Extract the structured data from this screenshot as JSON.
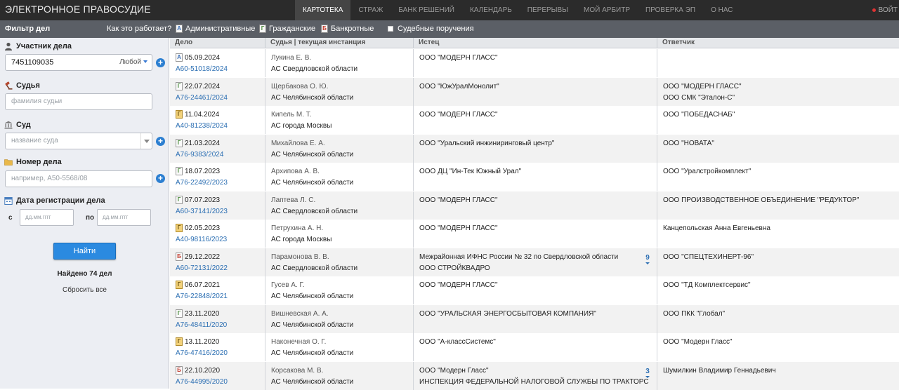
{
  "header": {
    "brand": "ЭЛЕКТРОННОЕ ПРАВОСУДИЕ",
    "nav": [
      "КАРТОТЕКА",
      "СТРАЖ",
      "БАНК РЕШЕНИЙ",
      "КАЛЕНДАРЬ",
      "ПЕРЕРЫВЫ",
      "МОЙ АРБИТР",
      "ПРОВЕРКА ЭП",
      "О НАС"
    ],
    "active_nav": "КАРТОТЕКА",
    "login": "ВОЙТ"
  },
  "filterbar": {
    "title": "Фильтр дел",
    "how": "Как это работает?",
    "types": [
      {
        "icon": "А",
        "label": "Административные"
      },
      {
        "icon": "Г",
        "label": "Гражданские"
      },
      {
        "icon": "Б",
        "label": "Банкротные"
      }
    ],
    "court_orders": "Судебные поручения"
  },
  "sidebar": {
    "participant_label": "Участник дела",
    "participant_value": "7451109035",
    "participant_any": "Любой",
    "judge_label": "Судья",
    "judge_placeholder": "фамилия судьи",
    "court_label": "Суд",
    "court_placeholder": "название суда",
    "case_label": "Номер дела",
    "case_placeholder": "например, А50-5568/08",
    "date_label": "Дата регистрации дела",
    "from_label": "с",
    "to_label": "по",
    "date_placeholder": "дд.мм.гггг",
    "find_button": "Найти",
    "found": "Найдено 74 дел",
    "reset": "Сбросить все"
  },
  "table": {
    "headers": [
      "Дело",
      "Судья | текущая инстанция",
      "Истец",
      "Ответчик"
    ],
    "rows": [
      {
        "type": "А",
        "date": "05.09.2024",
        "case": "А60-51018/2024",
        "judge": "Лукина Е. В.",
        "court": "АС Свердловской области",
        "plaintiff": [
          "ООО \"МОДЕРН ГЛАСС\""
        ],
        "defendant": [],
        "more": ""
      },
      {
        "type": "Г",
        "date": "22.07.2024",
        "case": "А76-24461/2024",
        "judge": "Щербакова О. Ю.",
        "court": "АС Челябинской области",
        "plaintiff": [
          "ООО \"ЮжУралМонолит\""
        ],
        "defendant": [
          "ООО \"МОДЕРН ГЛАСС\"",
          "ООО СМК \"Эталон-С\""
        ],
        "more": ""
      },
      {
        "type": "Г2",
        "date": "11.04.2024",
        "case": "А40-81238/2024",
        "judge": "Кипель М. Т.",
        "court": "АС города Москвы",
        "plaintiff": [
          "ООО \"МОДЕРН ГЛАСС\""
        ],
        "defendant": [
          "ООО \"ПОБЕДАСНАБ\""
        ],
        "more": ""
      },
      {
        "type": "Г",
        "date": "21.03.2024",
        "case": "А76-9383/2024",
        "judge": "Михайлова Е. А.",
        "court": "АС Челябинской области",
        "plaintiff": [
          "ООО \"Уральский инжиниринговый центр\""
        ],
        "defendant": [
          "ООО \"НОВАТА\""
        ],
        "more": ""
      },
      {
        "type": "Г",
        "date": "18.07.2023",
        "case": "А76-22492/2023",
        "judge": "Архипова А. В.",
        "court": "АС Челябинской области",
        "plaintiff": [
          "ООО ДЦ \"Ин-Тек Южный Урал\""
        ],
        "defendant": [
          "ООО \"Уралстройкомплект\""
        ],
        "more": ""
      },
      {
        "type": "Г",
        "date": "07.07.2023",
        "case": "А60-37141/2023",
        "judge": "Лаптева Л. С.",
        "court": "АС Свердловской области",
        "plaintiff": [
          "ООО \"МОДЕРН ГЛАСС\""
        ],
        "defendant": [
          "ООО ПРОИЗВОДСТВЕННОЕ ОБЪЕДИНЕНИЕ \"РЕДУКТОР\""
        ],
        "more": ""
      },
      {
        "type": "Г2",
        "date": "02.05.2023",
        "case": "А40-98116/2023",
        "judge": "Петрухина А. Н.",
        "court": "АС города Москвы",
        "plaintiff": [
          "ООО \"МОДЕРН ГЛАСС\""
        ],
        "defendant": [
          "Канцепольская Анна Евгеньевна"
        ],
        "more": ""
      },
      {
        "type": "Б",
        "date": "29.12.2022",
        "case": "А60-72131/2022",
        "judge": "Парамонова В. В.",
        "court": "АС Свердловской области",
        "plaintiff": [
          "Межрайонная ИФНС России № 32 по Свердловской области",
          "ООО СТРОЙКВАДРО"
        ],
        "defendant": [
          "ООО \"СПЕЦТЕХИНЕРТ-96\""
        ],
        "more": "9"
      },
      {
        "type": "Г2",
        "date": "06.07.2021",
        "case": "А76-22848/2021",
        "judge": "Гусев А. Г.",
        "court": "АС Челябинской области",
        "plaintiff": [
          "ООО \"МОДЕРН ГЛАСС\""
        ],
        "defendant": [
          "ООО \"ТД Комплектсервис\""
        ],
        "more": ""
      },
      {
        "type": "Г",
        "date": "23.11.2020",
        "case": "А76-48411/2020",
        "judge": "Вишневская А. А.",
        "court": "АС Челябинской области",
        "plaintiff": [
          "ООО \"УРАЛЬСКАЯ ЭНЕРГОСБЫТОВАЯ КОМПАНИЯ\""
        ],
        "defendant": [
          "ООО ПКК \"Глобал\""
        ],
        "more": ""
      },
      {
        "type": "Г2",
        "date": "13.11.2020",
        "case": "А76-47416/2020",
        "judge": "Наконечная О. Г.",
        "court": "АС Челябинской области",
        "plaintiff": [
          "ООО \"А-классСистемс\""
        ],
        "defendant": [
          "ООО \"Модерн Гласс\""
        ],
        "more": ""
      },
      {
        "type": "Б",
        "date": "22.10.2020",
        "case": "А76-44995/2020",
        "judge": "Корсакова М. В.",
        "court": "АС Челябинской области",
        "plaintiff": [
          "ООО \"Модерн Гласс\"",
          "ИНСПЕКЦИЯ ФЕДЕРАЛЬНОЙ НАЛОГОВОЙ СЛУЖБЫ ПО ТРАКТОРС"
        ],
        "defendant": [
          "Шумилкин Владимир Геннадьевич"
        ],
        "more": "3"
      }
    ]
  },
  "colors": {
    "topbar": "#2b2b2b",
    "filterbar": "#5b5f66",
    "link": "#2c6fb3",
    "button": "#2b8ae0"
  }
}
